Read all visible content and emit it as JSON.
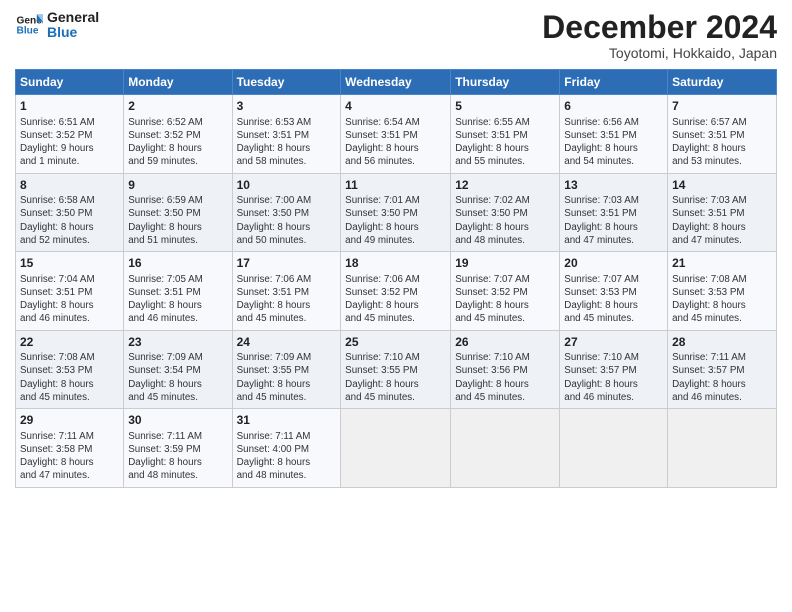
{
  "logo": {
    "line1": "General",
    "line2": "Blue"
  },
  "title": "December 2024",
  "location": "Toyotomi, Hokkaido, Japan",
  "weekdays": [
    "Sunday",
    "Monday",
    "Tuesday",
    "Wednesday",
    "Thursday",
    "Friday",
    "Saturday"
  ],
  "weeks": [
    [
      {
        "day": "1",
        "detail": "Sunrise: 6:51 AM\nSunset: 3:52 PM\nDaylight: 9 hours\nand 1 minute."
      },
      {
        "day": "2",
        "detail": "Sunrise: 6:52 AM\nSunset: 3:52 PM\nDaylight: 8 hours\nand 59 minutes."
      },
      {
        "day": "3",
        "detail": "Sunrise: 6:53 AM\nSunset: 3:51 PM\nDaylight: 8 hours\nand 58 minutes."
      },
      {
        "day": "4",
        "detail": "Sunrise: 6:54 AM\nSunset: 3:51 PM\nDaylight: 8 hours\nand 56 minutes."
      },
      {
        "day": "5",
        "detail": "Sunrise: 6:55 AM\nSunset: 3:51 PM\nDaylight: 8 hours\nand 55 minutes."
      },
      {
        "day": "6",
        "detail": "Sunrise: 6:56 AM\nSunset: 3:51 PM\nDaylight: 8 hours\nand 54 minutes."
      },
      {
        "day": "7",
        "detail": "Sunrise: 6:57 AM\nSunset: 3:51 PM\nDaylight: 8 hours\nand 53 minutes."
      }
    ],
    [
      {
        "day": "8",
        "detail": "Sunrise: 6:58 AM\nSunset: 3:50 PM\nDaylight: 8 hours\nand 52 minutes."
      },
      {
        "day": "9",
        "detail": "Sunrise: 6:59 AM\nSunset: 3:50 PM\nDaylight: 8 hours\nand 51 minutes."
      },
      {
        "day": "10",
        "detail": "Sunrise: 7:00 AM\nSunset: 3:50 PM\nDaylight: 8 hours\nand 50 minutes."
      },
      {
        "day": "11",
        "detail": "Sunrise: 7:01 AM\nSunset: 3:50 PM\nDaylight: 8 hours\nand 49 minutes."
      },
      {
        "day": "12",
        "detail": "Sunrise: 7:02 AM\nSunset: 3:50 PM\nDaylight: 8 hours\nand 48 minutes."
      },
      {
        "day": "13",
        "detail": "Sunrise: 7:03 AM\nSunset: 3:51 PM\nDaylight: 8 hours\nand 47 minutes."
      },
      {
        "day": "14",
        "detail": "Sunrise: 7:03 AM\nSunset: 3:51 PM\nDaylight: 8 hours\nand 47 minutes."
      }
    ],
    [
      {
        "day": "15",
        "detail": "Sunrise: 7:04 AM\nSunset: 3:51 PM\nDaylight: 8 hours\nand 46 minutes."
      },
      {
        "day": "16",
        "detail": "Sunrise: 7:05 AM\nSunset: 3:51 PM\nDaylight: 8 hours\nand 46 minutes."
      },
      {
        "day": "17",
        "detail": "Sunrise: 7:06 AM\nSunset: 3:51 PM\nDaylight: 8 hours\nand 45 minutes."
      },
      {
        "day": "18",
        "detail": "Sunrise: 7:06 AM\nSunset: 3:52 PM\nDaylight: 8 hours\nand 45 minutes."
      },
      {
        "day": "19",
        "detail": "Sunrise: 7:07 AM\nSunset: 3:52 PM\nDaylight: 8 hours\nand 45 minutes."
      },
      {
        "day": "20",
        "detail": "Sunrise: 7:07 AM\nSunset: 3:53 PM\nDaylight: 8 hours\nand 45 minutes."
      },
      {
        "day": "21",
        "detail": "Sunrise: 7:08 AM\nSunset: 3:53 PM\nDaylight: 8 hours\nand 45 minutes."
      }
    ],
    [
      {
        "day": "22",
        "detail": "Sunrise: 7:08 AM\nSunset: 3:53 PM\nDaylight: 8 hours\nand 45 minutes."
      },
      {
        "day": "23",
        "detail": "Sunrise: 7:09 AM\nSunset: 3:54 PM\nDaylight: 8 hours\nand 45 minutes."
      },
      {
        "day": "24",
        "detail": "Sunrise: 7:09 AM\nSunset: 3:55 PM\nDaylight: 8 hours\nand 45 minutes."
      },
      {
        "day": "25",
        "detail": "Sunrise: 7:10 AM\nSunset: 3:55 PM\nDaylight: 8 hours\nand 45 minutes."
      },
      {
        "day": "26",
        "detail": "Sunrise: 7:10 AM\nSunset: 3:56 PM\nDaylight: 8 hours\nand 45 minutes."
      },
      {
        "day": "27",
        "detail": "Sunrise: 7:10 AM\nSunset: 3:57 PM\nDaylight: 8 hours\nand 46 minutes."
      },
      {
        "day": "28",
        "detail": "Sunrise: 7:11 AM\nSunset: 3:57 PM\nDaylight: 8 hours\nand 46 minutes."
      }
    ],
    [
      {
        "day": "29",
        "detail": "Sunrise: 7:11 AM\nSunset: 3:58 PM\nDaylight: 8 hours\nand 47 minutes."
      },
      {
        "day": "30",
        "detail": "Sunrise: 7:11 AM\nSunset: 3:59 PM\nDaylight: 8 hours\nand 48 minutes."
      },
      {
        "day": "31",
        "detail": "Sunrise: 7:11 AM\nSunset: 4:00 PM\nDaylight: 8 hours\nand 48 minutes."
      },
      {
        "day": "",
        "detail": ""
      },
      {
        "day": "",
        "detail": ""
      },
      {
        "day": "",
        "detail": ""
      },
      {
        "day": "",
        "detail": ""
      }
    ]
  ]
}
